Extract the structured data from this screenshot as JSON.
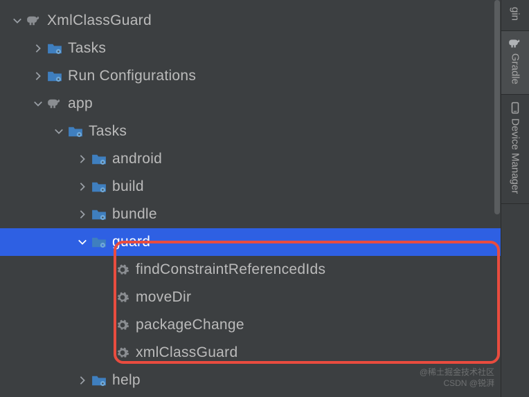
{
  "tree": {
    "root": {
      "label": "XmlClassGuard"
    },
    "root_children": [
      {
        "label": "Tasks"
      },
      {
        "label": "Run Configurations"
      }
    ],
    "app": {
      "label": "app"
    },
    "app_tasks": {
      "label": "Tasks"
    },
    "task_groups": [
      {
        "label": "android"
      },
      {
        "label": "build"
      },
      {
        "label": "bundle"
      },
      {
        "label": "guard"
      }
    ],
    "guard_tasks": [
      {
        "label": "findConstraintReferencedIds"
      },
      {
        "label": "moveDir"
      },
      {
        "label": "packageChange"
      },
      {
        "label": "xmlClassGuard"
      }
    ],
    "after_guard": {
      "label": "help"
    }
  },
  "rail": {
    "first": "gin",
    "gradle": "Gradle",
    "device": "Device Manager"
  },
  "watermark": {
    "line1": "@稀土掘金技术社区",
    "line2": "CSDN @锐湃"
  }
}
